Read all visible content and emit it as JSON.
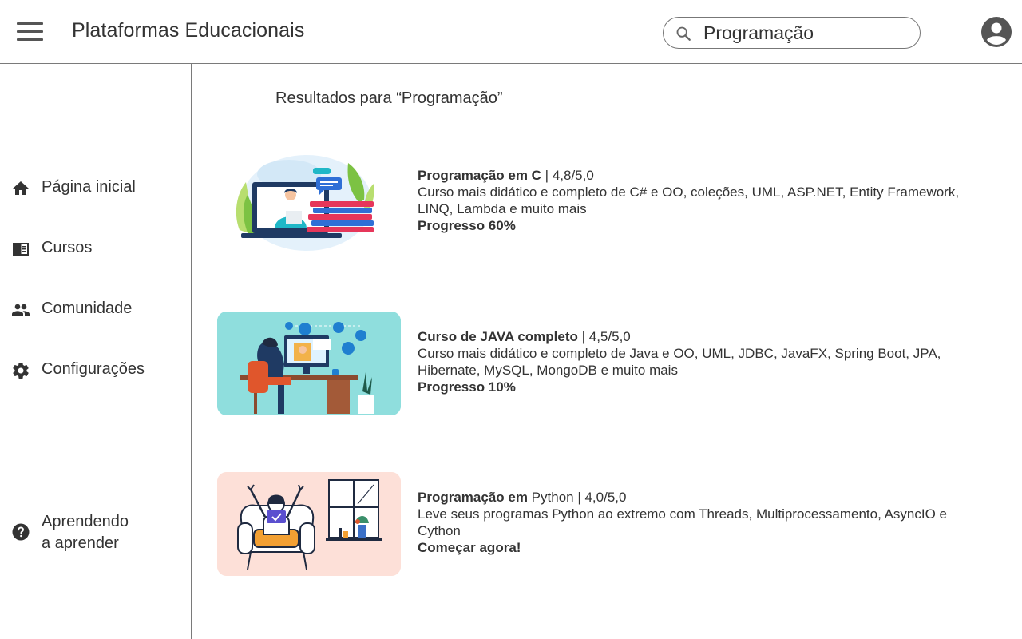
{
  "header": {
    "app_title": "Plataformas Educacionais",
    "menu_icon": "hamburger-menu-icon",
    "search_icon": "search-icon",
    "search_value": "Programação",
    "avatar_icon": "account-circle-icon"
  },
  "sidebar": {
    "items": [
      {
        "label": "Página inicial",
        "icon": "home-icon"
      },
      {
        "label": "Cursos",
        "icon": "chrome-reader-mode-icon"
      },
      {
        "label": "Comunidade",
        "icon": "people-icon"
      },
      {
        "label": "Configurações",
        "icon": "gear-icon"
      }
    ],
    "help": {
      "line1": "Aprendendo",
      "line2": "a aprender",
      "icon": "help-circle-icon"
    }
  },
  "main": {
    "results_title": "Resultados para “Programação”",
    "courses": [
      {
        "title_bold": "Programação em C",
        "title_regular": "",
        "rating": " | 4,8/5,0",
        "description": "Curso mais didático e completo de C# e OO, coleções, UML, ASP.NET, Entity Framework, LINQ, Lambda e muito mais",
        "status": "Progresso 60%",
        "thumb_bg": "#ffffff"
      },
      {
        "title_bold": "Curso de JAVA completo",
        "title_regular": "",
        "rating": " | 4,5/5,0",
        "description": "Curso mais didático e completo de Java e OO, UML, JDBC, JavaFX, Spring Boot, JPA, Hibernate, MySQL, MongoDB e muito mais",
        "status": "Progresso 10%",
        "thumb_bg": "#8fdedd"
      },
      {
        "title_bold": "Programação em",
        "title_regular": " Python",
        "rating": " | 4,0/5,0",
        "description": "Leve seus programas Python ao extremo com Threads, Multiprocessamento, AsyncIO e Cython",
        "status": "Começar agora!",
        "thumb_bg": "#fde0d8"
      }
    ]
  },
  "colors": {
    "border": "#7a7a7a",
    "text": "#333333",
    "icon": "#555555"
  }
}
